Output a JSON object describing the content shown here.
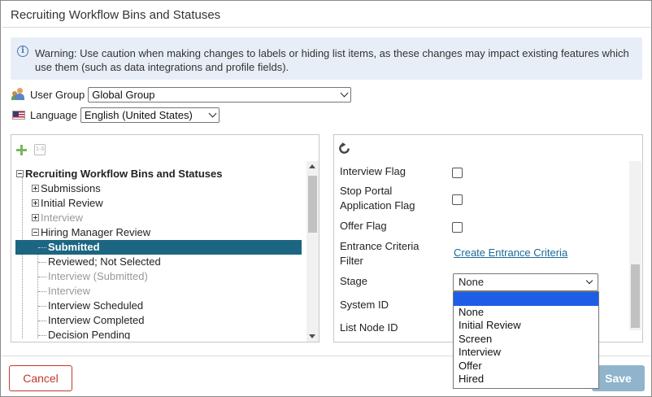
{
  "dialog": {
    "title": "Recruiting Workflow Bins and Statuses"
  },
  "warning": {
    "text": "Warning: Use caution when making changes to labels or hiding list items, as these changes may impact existing features which use them (such as data integrations and profile fields)."
  },
  "user_group": {
    "label": "User Group",
    "value": "Global Group"
  },
  "language": {
    "label": "Language",
    "value": "English (United States)"
  },
  "tree": {
    "root": "Recruiting Workflow Bins and Statuses",
    "items": [
      {
        "label": "Submissions"
      },
      {
        "label": "Initial Review"
      },
      {
        "label": "Interview"
      },
      {
        "label": "Hiring Manager Review"
      },
      {
        "label": "Submitted"
      },
      {
        "label": "Reviewed; Not Selected"
      },
      {
        "label": "Interview (Submitted)"
      },
      {
        "label": "Interview"
      },
      {
        "label": "Interview Scheduled"
      },
      {
        "label": "Interview Completed"
      },
      {
        "label": "Decision Pending"
      }
    ]
  },
  "properties": {
    "interview_flag": "Interview Flag",
    "stop_portal_line1": "Stop Portal",
    "stop_portal_line2": "Application Flag",
    "offer_flag": "Offer Flag",
    "entrance_line1": "Entrance Criteria",
    "entrance_line2": "Filter",
    "entrance_link": "Create Entrance Criteria",
    "stage_label": "Stage",
    "stage_value": "None",
    "system_id": "System ID",
    "list_node_id": "List Node ID"
  },
  "stage_dropdown": {
    "options": [
      "",
      "None",
      "Initial Review",
      "Screen",
      "Interview",
      "Offer",
      "Hired"
    ]
  },
  "footer": {
    "cancel": "Cancel",
    "save": "Save"
  },
  "colors": {
    "selected_row": "#1c6682",
    "cancel": "#c0392b",
    "save": "#8fb4cc",
    "link": "#1a6a9a"
  }
}
